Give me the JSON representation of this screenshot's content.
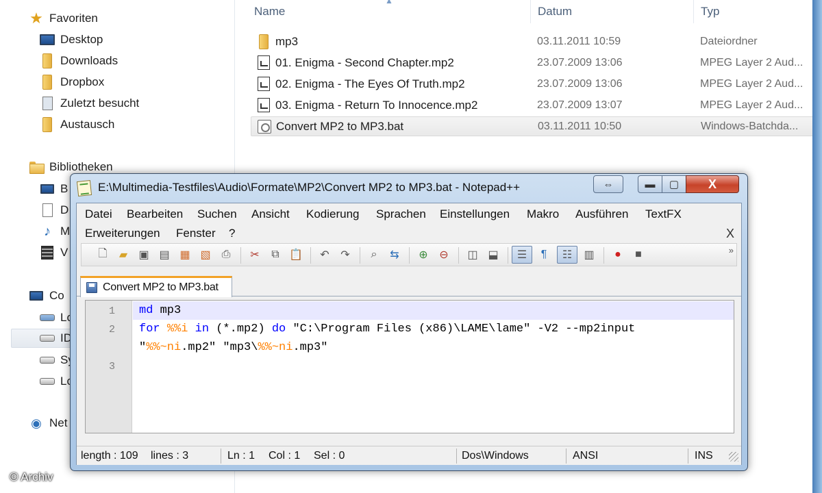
{
  "explorer": {
    "nav": {
      "favorites_header": "Favoriten",
      "favorites": [
        "Desktop",
        "Downloads",
        "Dropbox",
        "Zuletzt besucht",
        "Austausch"
      ],
      "libraries_header": "Bibliotheken",
      "libraries_partial": [
        "B",
        "D",
        "M",
        "V"
      ],
      "computer_header_partial": "Co",
      "computer_items_partial": [
        "Lo",
        "ID",
        "Sy",
        "Lo"
      ],
      "network_partial": "Net"
    },
    "columns": {
      "name": "Name",
      "date": "Datum",
      "type": "Typ"
    },
    "files": [
      {
        "icon": "folder-icon",
        "name": "mp3",
        "date": "03.11.2011 10:59",
        "type": "Dateiordner"
      },
      {
        "icon": "audio-file-icon",
        "name": "01. Enigma - Second Chapter.mp2",
        "date": "23.07.2009 13:06",
        "type": "MPEG Layer 2 Aud..."
      },
      {
        "icon": "audio-file-icon",
        "name": "02. Enigma - The Eyes Of Truth.mp2",
        "date": "23.07.2009 13:06",
        "type": "MPEG Layer 2 Aud..."
      },
      {
        "icon": "audio-file-icon",
        "name": "03. Enigma - Return To Innocence.mp2",
        "date": "23.07.2009 13:07",
        "type": "MPEG Layer 2 Aud..."
      },
      {
        "icon": "batch-file-icon",
        "name": "Convert MP2 to MP3.bat",
        "date": "03.11.2011 10:50",
        "type": "Windows-Batchda...",
        "selected": true
      }
    ]
  },
  "notepad": {
    "title": "E:\\Multimedia-Testfiles\\Audio\\Formate\\MP2\\Convert MP2 to MP3.bat - Notepad++",
    "caption_buttons": {
      "resize": "⇔",
      "minimize": "▬",
      "maximize": "▢",
      "close": "X"
    },
    "menu_row1": [
      "Datei",
      "Bearbeiten",
      "Suchen",
      "Ansicht",
      "Kodierung",
      "Sprachen",
      "Einstellungen",
      "Makro",
      "Ausführen",
      "TextFX"
    ],
    "menu_row2": [
      "Erweiterungen",
      "Fenster",
      "?"
    ],
    "menu_close": "X",
    "toolbar_more": "»",
    "tab_label": "Convert MP2 to MP3.bat",
    "line_numbers": [
      "1",
      "2",
      "3"
    ],
    "code": {
      "line1": {
        "kw": "md",
        "rest": " mp3"
      },
      "line2a": {
        "kw_for": "for",
        "var": "%%i",
        "kw_in": "in",
        "mid": " (*.mp2) ",
        "kw_do": "do",
        "rest": " \"C:\\Program Files (x86)\\LAME\\lame\" -V2 --mp2input"
      },
      "line2b": {
        "q1": "\"",
        "var1": "%%~ni",
        "mid": ".mp2\" \"mp3\\",
        "var2": "%%~ni",
        "end": ".mp3\""
      }
    },
    "status": {
      "length": "length : 109",
      "lines": "lines : 3",
      "ln": "Ln : 1",
      "col": "Col : 1",
      "sel": "Sel : 0",
      "eol": "Dos\\Windows",
      "encoding": "ANSI",
      "mode": "INS"
    }
  },
  "watermark": "© Archiv",
  "colors": {
    "keyword": "#0000ff",
    "variable": "#ff8000",
    "tab_accent": "#f2a227",
    "close_button": "#c7432a"
  }
}
